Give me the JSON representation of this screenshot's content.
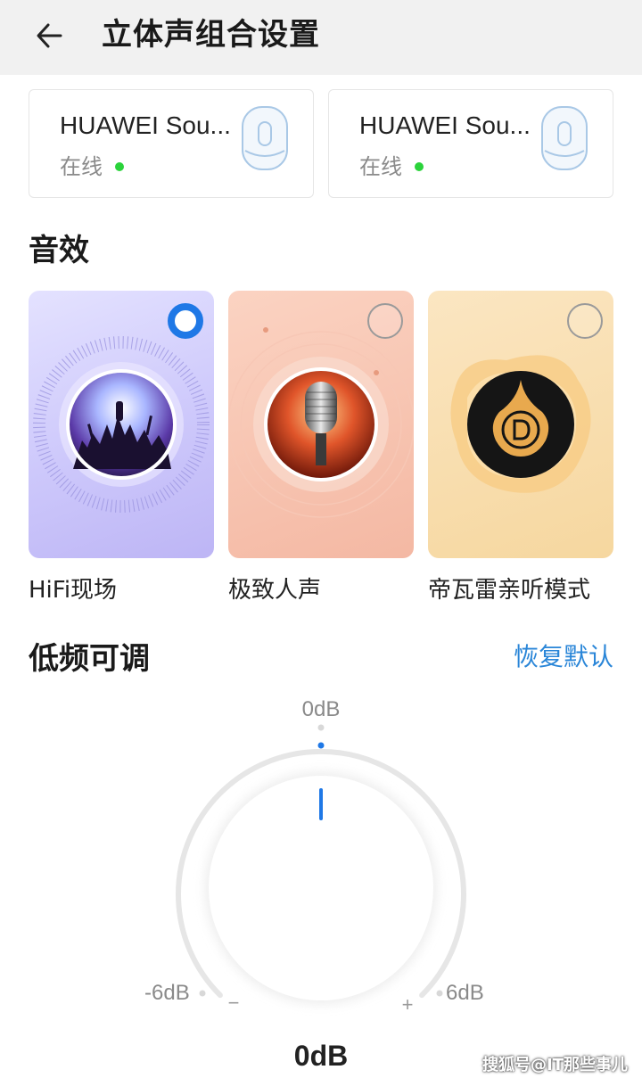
{
  "header": {
    "title": "立体声组合设置"
  },
  "devices": [
    {
      "name": "HUAWEI Sou...",
      "status": "在线"
    },
    {
      "name": "HUAWEI Sou...",
      "status": "在线"
    }
  ],
  "sound_effects": {
    "section_title": "音效",
    "selected_index": 0,
    "items": [
      {
        "label": "HiFi现场",
        "selected": true
      },
      {
        "label": "极致人声",
        "selected": false
      },
      {
        "label": "帝瓦雷亲听模式",
        "selected": false
      }
    ]
  },
  "bass": {
    "section_title": "低频可调",
    "restore_label": "恢复默认",
    "top_label": "0dB",
    "min_label": "-6dB",
    "max_label": "6dB",
    "minus_symbol": "−",
    "plus_symbol": "+",
    "current_value": "0dB",
    "value_db": 0
  },
  "watermark": "搜狐号@IT那些事儿",
  "colors": {
    "accent": "#1f78e6",
    "link": "#2a86d8",
    "online": "#2bd33b",
    "header_bg": "#f1f1f1"
  },
  "icons": [
    "back-arrow-icon",
    "speaker-icon",
    "radio-selected-icon",
    "radio-unselected-icon",
    "concert-crowd-image",
    "microphone-image",
    "devialet-logo"
  ]
}
